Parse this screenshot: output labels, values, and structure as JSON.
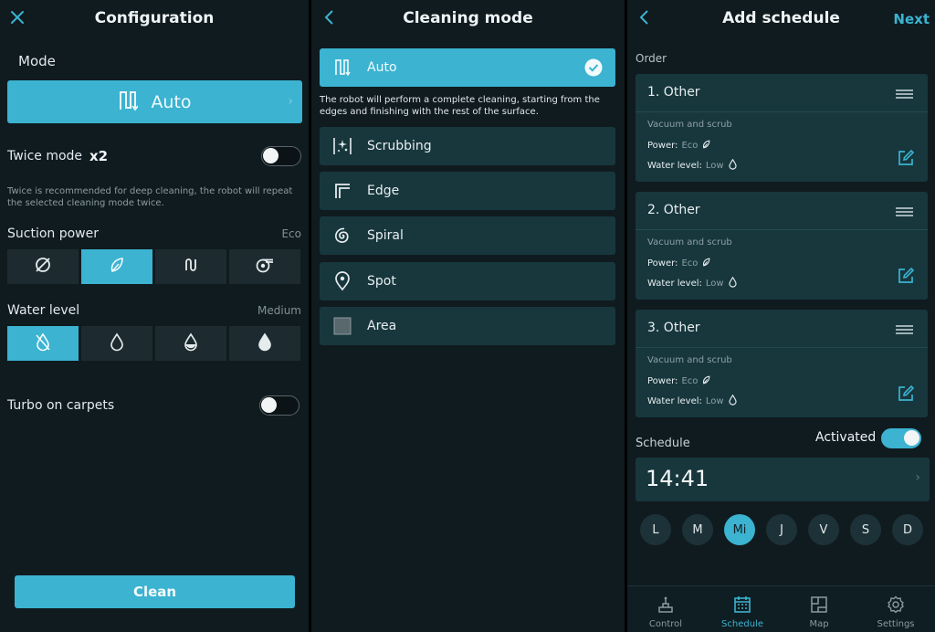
{
  "configuration": {
    "title": "Configuration",
    "close_icon": "close-icon",
    "mode_label": "Mode",
    "mode_value": "Auto",
    "twice_label": "Twice mode",
    "twice_badge": "x2",
    "twice_toggle_on": false,
    "twice_desc": "Twice is recommended for deep cleaning, the robot will repeat the selected cleaning mode twice.",
    "suction_label": "Suction power",
    "suction_value": "Eco",
    "suction_icons": [
      "off-icon",
      "eco-leaf-icon",
      "normal-icon",
      "turbo-fan-icon"
    ],
    "suction_selected": 1,
    "water_label": "Water level",
    "water_value": "Medium",
    "water_icons": [
      "water-off-icon",
      "water-low-icon",
      "water-medium-icon",
      "water-high-icon"
    ],
    "water_selected": 0,
    "turbo_label": "Turbo on carpets",
    "turbo_toggle_on": false,
    "clean_button": "Clean"
  },
  "cleaning_mode": {
    "title": "Cleaning mode",
    "back_icon": "back-chevron-icon",
    "selected_label": "Auto",
    "description": "The robot will perform a complete cleaning, starting from the edges and finishing with the rest of the surface.",
    "modes": [
      {
        "label": "Scrubbing",
        "icon": "scrubbing-icon"
      },
      {
        "label": "Edge",
        "icon": "edge-icon"
      },
      {
        "label": "Spiral",
        "icon": "spiral-icon"
      },
      {
        "label": "Spot",
        "icon": "spot-pin-icon"
      },
      {
        "label": "Area",
        "icon": "area-square-icon"
      }
    ]
  },
  "add_schedule": {
    "title": "Add schedule",
    "back_icon": "back-chevron-icon",
    "next_label": "Next",
    "order_label": "Order",
    "items": [
      {
        "title": "1. Other",
        "type": "Vacuum and scrub",
        "power_label": "Power:",
        "power_value": "Eco",
        "water_label": "Water level:",
        "water_value": "Low"
      },
      {
        "title": "2. Other",
        "type": "Vacuum and scrub",
        "power_label": "Power:",
        "power_value": "Eco",
        "water_label": "Water level:",
        "water_value": "Low"
      },
      {
        "title": "3. Other",
        "type": "Vacuum and scrub",
        "power_label": "Power:",
        "power_value": "Eco",
        "water_label": "Water level:",
        "water_value": "Low"
      }
    ],
    "schedule_label": "Schedule",
    "activated_label": "Activated",
    "activated_on": true,
    "time": "14:41",
    "days": [
      "L",
      "M",
      "Mi",
      "J",
      "V",
      "S",
      "D"
    ],
    "selected_day": 2,
    "tabs": [
      {
        "label": "Control",
        "icon": "robot-control-icon"
      },
      {
        "label": "Schedule",
        "icon": "calendar-icon"
      },
      {
        "label": "Map",
        "icon": "map-icon"
      },
      {
        "label": "Settings",
        "icon": "gear-icon"
      }
    ],
    "selected_tab": 1
  },
  "colors": {
    "accent": "#3bb3d1",
    "background": "#101b1f",
    "card": "#17373d"
  }
}
